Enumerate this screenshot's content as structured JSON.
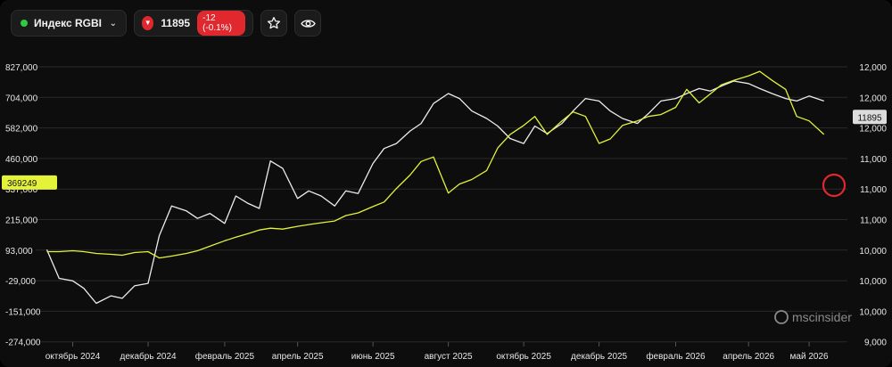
{
  "toolbar": {
    "symbol_name": "Индекс RGBI",
    "price": "11895",
    "change": "-12 (-0.1%)",
    "status_color": "#2ecc40",
    "down_color": "#e0282e",
    "star_icon": "star-icon",
    "eye_icon": "eye-icon"
  },
  "watermark": "mscinsider",
  "colors": {
    "white_series": "#ececec",
    "yellow_series": "#e4f23a",
    "grid": "#2a2a2a",
    "axis_text": "#e6e6e6",
    "circle": "#e0282e"
  },
  "chart_data": {
    "type": "line",
    "left_axis_ticks": [
      "827,000",
      "704,000",
      "582,000",
      "460,000",
      "337,000",
      "215,000",
      "93,000",
      "-29,000",
      "-151,000",
      "-274,000"
    ],
    "left_axis_values": [
      827000,
      704000,
      582000,
      460000,
      337000,
      215000,
      93000,
      -29000,
      -151000,
      -274000
    ],
    "right_axis_ticks": [
      "12,000",
      "12,000",
      "12,000",
      "11,000",
      "11,000",
      "11,000",
      "10,000",
      "10,000",
      "10,000",
      "9,000"
    ],
    "x_ticks": [
      "октябрь 2024",
      "декабрь 2024",
      "февраль 2025",
      "апрель 2025",
      "июнь 2025",
      "август 2025",
      "октябрь 2025",
      "декабрь 2025",
      "февраль 2026",
      "апрель 2026",
      "май 2026"
    ],
    "left_last_label": "369249",
    "right_last_label": "11895",
    "series": [
      {
        "axis": "left",
        "x": [
          "2024-09-10",
          "2024-09-20",
          "2024-10-01",
          "2024-10-10",
          "2024-10-20",
          "2024-11-01",
          "2024-11-10",
          "2024-11-20",
          "2024-12-01",
          "2024-12-10",
          "2024-12-20",
          "2025-01-01",
          "2025-01-10",
          "2025-01-20",
          "2025-02-01",
          "2025-02-10",
          "2025-02-20",
          "2025-03-01",
          "2025-03-10",
          "2025-03-20",
          "2025-04-01",
          "2025-04-10",
          "2025-04-20",
          "2025-05-01",
          "2025-05-10",
          "2025-05-20",
          "2025-06-01",
          "2025-06-10",
          "2025-06-20",
          "2025-07-01",
          "2025-07-10",
          "2025-07-20",
          "2025-08-01",
          "2025-08-10",
          "2025-08-20",
          "2025-09-01",
          "2025-09-10",
          "2025-09-20",
          "2025-10-01",
          "2025-10-10",
          "2025-10-20",
          "2025-11-01",
          "2025-11-10",
          "2025-11-20",
          "2025-12-01",
          "2025-12-10",
          "2025-12-20",
          "2026-01-01",
          "2026-01-10",
          "2026-01-20",
          "2026-02-01",
          "2026-02-10",
          "2026-02-20",
          "2026-03-01",
          "2026-03-10",
          "2026-03-20",
          "2026-04-01",
          "2026-04-10",
          "2026-04-20",
          "2026-05-01",
          "2026-05-10",
          "2026-05-20",
          "2026-06-01"
        ],
        "y": [
          95000,
          -20000,
          -30000,
          -60000,
          -120000,
          -90000,
          -100000,
          -50000,
          -40000,
          150000,
          270000,
          250000,
          220000,
          240000,
          200000,
          310000,
          280000,
          260000,
          450000,
          420000,
          300000,
          330000,
          310000,
          270000,
          330000,
          320000,
          440000,
          500000,
          520000,
          570000,
          600000,
          680000,
          720000,
          700000,
          650000,
          620000,
          590000,
          540000,
          520000,
          590000,
          560000,
          600000,
          650000,
          700000,
          690000,
          650000,
          620000,
          600000,
          640000,
          690000,
          700000,
          720000,
          740000,
          730000,
          750000,
          770000,
          760000,
          740000,
          720000,
          700000,
          690000,
          710000,
          690000
        ]
      },
      {
        "axis": "right",
        "x": [
          "2024-09-10",
          "2024-09-20",
          "2024-10-01",
          "2024-10-10",
          "2024-10-20",
          "2024-11-01",
          "2024-11-10",
          "2024-11-20",
          "2024-12-01",
          "2024-12-10",
          "2024-12-20",
          "2025-01-01",
          "2025-01-10",
          "2025-01-20",
          "2025-02-01",
          "2025-02-10",
          "2025-02-20",
          "2025-03-01",
          "2025-03-10",
          "2025-03-20",
          "2025-04-01",
          "2025-04-10",
          "2025-04-20",
          "2025-05-01",
          "2025-05-10",
          "2025-05-20",
          "2025-06-01",
          "2025-06-10",
          "2025-06-20",
          "2025-07-01",
          "2025-07-10",
          "2025-07-20",
          "2025-08-01",
          "2025-08-10",
          "2025-08-20",
          "2025-09-01",
          "2025-09-10",
          "2025-09-20",
          "2025-10-01",
          "2025-10-10",
          "2025-10-20",
          "2025-11-01",
          "2025-11-10",
          "2025-11-20",
          "2025-12-01",
          "2025-12-10",
          "2025-12-20",
          "2026-01-01",
          "2026-01-10",
          "2026-01-20",
          "2026-02-01",
          "2026-02-10",
          "2026-02-20",
          "2026-03-01",
          "2026-03-10",
          "2026-03-20",
          "2026-04-01",
          "2026-04-10",
          "2026-04-20",
          "2026-05-01",
          "2026-05-10",
          "2026-05-20",
          "2026-06-01"
        ],
        "y": [
          10000,
          10000,
          10010,
          10000,
          9980,
          9970,
          9960,
          9990,
          10000,
          9930,
          9950,
          9980,
          10010,
          10060,
          10120,
          10160,
          10200,
          10240,
          10260,
          10250,
          10280,
          10300,
          10320,
          10340,
          10400,
          10430,
          10500,
          10550,
          10700,
          10850,
          11000,
          11050,
          10650,
          10750,
          10800,
          10900,
          11150,
          11300,
          11400,
          11500,
          11300,
          11450,
          11550,
          11500,
          11200,
          11250,
          11400,
          11450,
          11500,
          11520,
          11600,
          11800,
          11650,
          11750,
          11850,
          11900,
          11950,
          12000,
          11900,
          11800,
          11500,
          11450,
          11300
        ]
      }
    ]
  }
}
